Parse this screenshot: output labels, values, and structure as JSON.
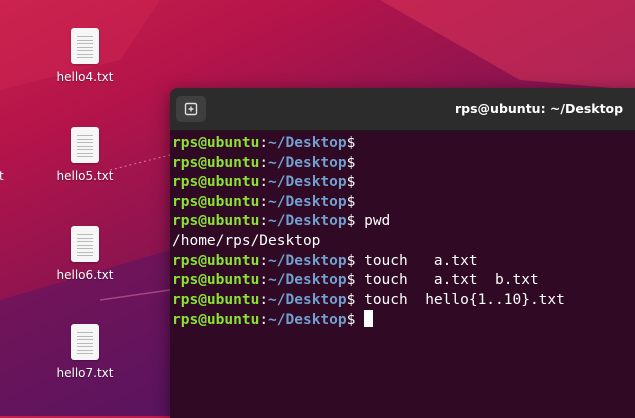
{
  "desktop": {
    "icons": [
      {
        "label": "hello4.txt"
      },
      {
        "label": "hello5.txt"
      },
      {
        "label": "hello6.txt"
      },
      {
        "label": "hello7.txt"
      }
    ],
    "partial_left_label": "t"
  },
  "terminal": {
    "title": "rps@ubuntu: ~/Desktop",
    "prompt": {
      "user": "rps@ubuntu",
      "sep": ":",
      "path": "~/Desktop",
      "symbol": "$"
    },
    "lines": [
      {
        "type": "prompt",
        "cmd": ""
      },
      {
        "type": "prompt",
        "cmd": ""
      },
      {
        "type": "prompt",
        "cmd": ""
      },
      {
        "type": "prompt",
        "cmd": ""
      },
      {
        "type": "prompt",
        "cmd": " pwd"
      },
      {
        "type": "output",
        "text": "/home/rps/Desktop"
      },
      {
        "type": "prompt",
        "cmd": " touch   a.txt"
      },
      {
        "type": "prompt",
        "cmd": " touch   a.txt  b.txt"
      },
      {
        "type": "prompt",
        "cmd": " touch  hello{1..10}.txt"
      },
      {
        "type": "prompt",
        "cmd": " ",
        "cursor": true
      }
    ]
  },
  "colors": {
    "terminal_bg": "#300a24",
    "prompt_user": "#8ae234",
    "prompt_path": "#729fcf",
    "titlebar": "#2c2c2c"
  }
}
